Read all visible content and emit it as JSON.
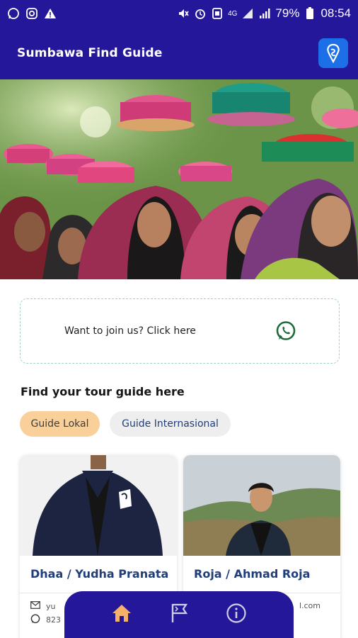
{
  "status_bar": {
    "battery": "79%",
    "time": "08:54",
    "network": "4G"
  },
  "app_bar": {
    "title": "Sumbawa Find Guide"
  },
  "cta": {
    "text": "Want to join us? Click here"
  },
  "section": {
    "title": "Find your tour guide here"
  },
  "filters": [
    {
      "label": "Guide Lokal",
      "active": true
    },
    {
      "label": "Guide Internasional",
      "active": false
    }
  ],
  "guides": [
    {
      "name": "Dhaa / Yudha Pranata",
      "email": "yu",
      "phone": "823"
    },
    {
      "name": "Roja / Ahmad Roja",
      "email": "l.com",
      "phone": ""
    }
  ],
  "colors": {
    "primary": "#24179a",
    "accent_chip": "#f9cf9a",
    "name_blue": "#1f3e7a",
    "home_active": "#f5b06a"
  },
  "nav": [
    "home-icon",
    "flag-icon",
    "info-icon"
  ]
}
